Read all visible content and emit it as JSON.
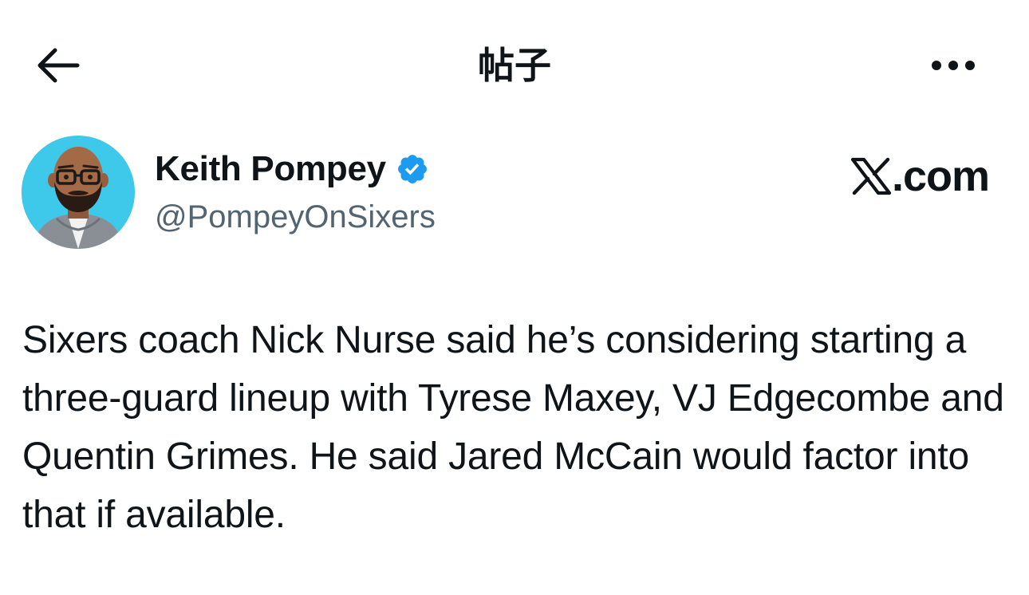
{
  "header": {
    "title": "帖子",
    "back_icon": "arrow-left-icon",
    "more_icon": "more-horizontal-icon"
  },
  "author": {
    "display_name": "Keith Pompey",
    "handle": "@PompeyOnSixers",
    "verified": true,
    "verified_icon": "verified-badge-icon",
    "avatar_icon": "avatar-memoji",
    "avatar_bg": "#3ec8ea"
  },
  "brand": {
    "mark": "𝕏",
    "label": ".com"
  },
  "tweet": {
    "text": "Sixers coach Nick Nurse said he’s considering starting a three-guard lineup with Tyrese Maxey, VJ Edgecombe and Quentin Grimes. He said Jared McCain would factor into that if available."
  },
  "colors": {
    "text_primary": "#0f1419",
    "text_secondary": "#536471",
    "verified_blue": "#1d9bf0",
    "background": "#ffffff"
  }
}
